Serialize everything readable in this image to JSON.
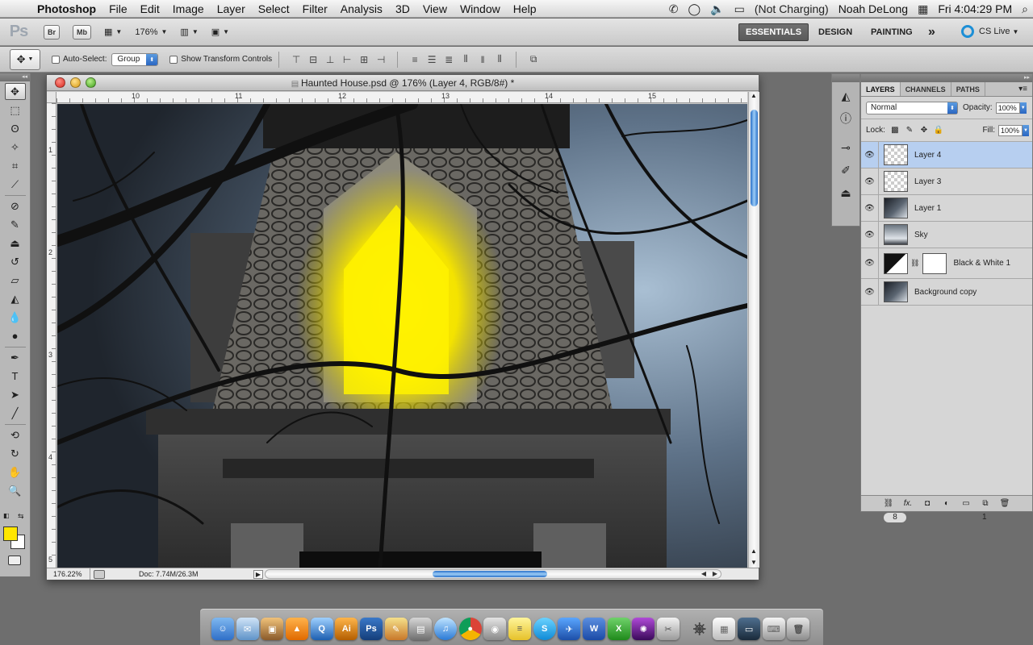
{
  "menubar": {
    "app_name": "Photoshop",
    "menus": [
      "File",
      "Edit",
      "Image",
      "Layer",
      "Select",
      "Filter",
      "Analysis",
      "3D",
      "View",
      "Window",
      "Help"
    ],
    "battery": "(Not Charging)",
    "user": "Noah DeLong",
    "clock": "Fri 4:04:29 PM"
  },
  "appbar": {
    "logo": "Ps",
    "bridge": "Br",
    "minibridge": "Mb",
    "zoom": "176%",
    "workspaces": [
      "ESSENTIALS",
      "DESIGN",
      "PAINTING"
    ],
    "more": "»",
    "cslive": "CS Live"
  },
  "options": {
    "auto_select_label": "Auto-Select:",
    "auto_select_target": "Group",
    "transform_label": "Show Transform Controls"
  },
  "document": {
    "title": "Haunted House.psd @ 176% (Layer 4, RGB/8#) *",
    "ruler_h": [
      "10",
      "11",
      "12",
      "13",
      "14",
      "15"
    ],
    "ruler_v": [
      "1",
      "2",
      "3",
      "4",
      "5"
    ],
    "zoom_readout": "176.22%",
    "doc_info": "Doc: 7.74M/26.3M"
  },
  "colors": {
    "foreground": "#ffe600",
    "background": "#ffffff",
    "glow": "#fff200",
    "selection": "#b7cff0",
    "accent": "#2b67c2"
  },
  "layers_panel": {
    "tabs": [
      "LAYERS",
      "CHANNELS",
      "PATHS"
    ],
    "blend_mode": "Normal",
    "opacity_label": "Opacity:",
    "opacity": "100%",
    "lock_label": "Lock:",
    "fill_label": "Fill:",
    "fill": "100%",
    "layers": [
      {
        "name": "Layer 4",
        "selected": true
      },
      {
        "name": "Layer 3",
        "selected": false
      },
      {
        "name": "Layer 1",
        "selected": false
      },
      {
        "name": "Sky",
        "selected": false
      },
      {
        "name": "Black & White 1",
        "selected": false
      },
      {
        "name": "Background copy",
        "selected": false
      }
    ],
    "badge_left": "8",
    "badge_right": "1"
  },
  "dock": {
    "apps": [
      "finder-icon",
      "mail-icon",
      "iphoto-icon",
      "vlc-icon",
      "quicktime-icon",
      "illustrator-icon",
      "photoshop-icon",
      "pages-icon",
      "preview-icon",
      "itunes-icon",
      "chrome-icon",
      "camera-icon",
      "stickies-icon",
      "skype-icon",
      "twitter-icon",
      "word-icon",
      "excel-icon",
      "aperture-icon",
      "preview2-icon",
      "cleanup-icon",
      "calendar-icon",
      "display-icon",
      "keyboard-icon",
      "trash-icon"
    ]
  }
}
